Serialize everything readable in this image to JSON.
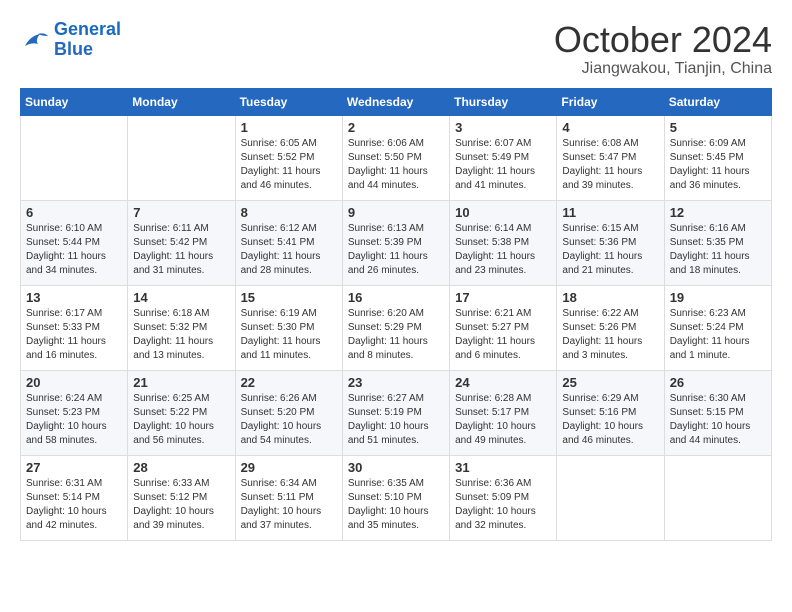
{
  "header": {
    "logo": {
      "line1": "General",
      "line2": "Blue"
    },
    "title": "October 2024",
    "location": "Jiangwakou, Tianjin, China"
  },
  "weekdays": [
    "Sunday",
    "Monday",
    "Tuesday",
    "Wednesday",
    "Thursday",
    "Friday",
    "Saturday"
  ],
  "weeks": [
    [
      {
        "day": "",
        "info": ""
      },
      {
        "day": "",
        "info": ""
      },
      {
        "day": "1",
        "info": "Sunrise: 6:05 AM\nSunset: 5:52 PM\nDaylight: 11 hours\nand 46 minutes."
      },
      {
        "day": "2",
        "info": "Sunrise: 6:06 AM\nSunset: 5:50 PM\nDaylight: 11 hours\nand 44 minutes."
      },
      {
        "day": "3",
        "info": "Sunrise: 6:07 AM\nSunset: 5:49 PM\nDaylight: 11 hours\nand 41 minutes."
      },
      {
        "day": "4",
        "info": "Sunrise: 6:08 AM\nSunset: 5:47 PM\nDaylight: 11 hours\nand 39 minutes."
      },
      {
        "day": "5",
        "info": "Sunrise: 6:09 AM\nSunset: 5:45 PM\nDaylight: 11 hours\nand 36 minutes."
      }
    ],
    [
      {
        "day": "6",
        "info": "Sunrise: 6:10 AM\nSunset: 5:44 PM\nDaylight: 11 hours\nand 34 minutes."
      },
      {
        "day": "7",
        "info": "Sunrise: 6:11 AM\nSunset: 5:42 PM\nDaylight: 11 hours\nand 31 minutes."
      },
      {
        "day": "8",
        "info": "Sunrise: 6:12 AM\nSunset: 5:41 PM\nDaylight: 11 hours\nand 28 minutes."
      },
      {
        "day": "9",
        "info": "Sunrise: 6:13 AM\nSunset: 5:39 PM\nDaylight: 11 hours\nand 26 minutes."
      },
      {
        "day": "10",
        "info": "Sunrise: 6:14 AM\nSunset: 5:38 PM\nDaylight: 11 hours\nand 23 minutes."
      },
      {
        "day": "11",
        "info": "Sunrise: 6:15 AM\nSunset: 5:36 PM\nDaylight: 11 hours\nand 21 minutes."
      },
      {
        "day": "12",
        "info": "Sunrise: 6:16 AM\nSunset: 5:35 PM\nDaylight: 11 hours\nand 18 minutes."
      }
    ],
    [
      {
        "day": "13",
        "info": "Sunrise: 6:17 AM\nSunset: 5:33 PM\nDaylight: 11 hours\nand 16 minutes."
      },
      {
        "day": "14",
        "info": "Sunrise: 6:18 AM\nSunset: 5:32 PM\nDaylight: 11 hours\nand 13 minutes."
      },
      {
        "day": "15",
        "info": "Sunrise: 6:19 AM\nSunset: 5:30 PM\nDaylight: 11 hours\nand 11 minutes."
      },
      {
        "day": "16",
        "info": "Sunrise: 6:20 AM\nSunset: 5:29 PM\nDaylight: 11 hours\nand 8 minutes."
      },
      {
        "day": "17",
        "info": "Sunrise: 6:21 AM\nSunset: 5:27 PM\nDaylight: 11 hours\nand 6 minutes."
      },
      {
        "day": "18",
        "info": "Sunrise: 6:22 AM\nSunset: 5:26 PM\nDaylight: 11 hours\nand 3 minutes."
      },
      {
        "day": "19",
        "info": "Sunrise: 6:23 AM\nSunset: 5:24 PM\nDaylight: 11 hours\nand 1 minute."
      }
    ],
    [
      {
        "day": "20",
        "info": "Sunrise: 6:24 AM\nSunset: 5:23 PM\nDaylight: 10 hours\nand 58 minutes."
      },
      {
        "day": "21",
        "info": "Sunrise: 6:25 AM\nSunset: 5:22 PM\nDaylight: 10 hours\nand 56 minutes."
      },
      {
        "day": "22",
        "info": "Sunrise: 6:26 AM\nSunset: 5:20 PM\nDaylight: 10 hours\nand 54 minutes."
      },
      {
        "day": "23",
        "info": "Sunrise: 6:27 AM\nSunset: 5:19 PM\nDaylight: 10 hours\nand 51 minutes."
      },
      {
        "day": "24",
        "info": "Sunrise: 6:28 AM\nSunset: 5:17 PM\nDaylight: 10 hours\nand 49 minutes."
      },
      {
        "day": "25",
        "info": "Sunrise: 6:29 AM\nSunset: 5:16 PM\nDaylight: 10 hours\nand 46 minutes."
      },
      {
        "day": "26",
        "info": "Sunrise: 6:30 AM\nSunset: 5:15 PM\nDaylight: 10 hours\nand 44 minutes."
      }
    ],
    [
      {
        "day": "27",
        "info": "Sunrise: 6:31 AM\nSunset: 5:14 PM\nDaylight: 10 hours\nand 42 minutes."
      },
      {
        "day": "28",
        "info": "Sunrise: 6:33 AM\nSunset: 5:12 PM\nDaylight: 10 hours\nand 39 minutes."
      },
      {
        "day": "29",
        "info": "Sunrise: 6:34 AM\nSunset: 5:11 PM\nDaylight: 10 hours\nand 37 minutes."
      },
      {
        "day": "30",
        "info": "Sunrise: 6:35 AM\nSunset: 5:10 PM\nDaylight: 10 hours\nand 35 minutes."
      },
      {
        "day": "31",
        "info": "Sunrise: 6:36 AM\nSunset: 5:09 PM\nDaylight: 10 hours\nand 32 minutes."
      },
      {
        "day": "",
        "info": ""
      },
      {
        "day": "",
        "info": ""
      }
    ]
  ]
}
